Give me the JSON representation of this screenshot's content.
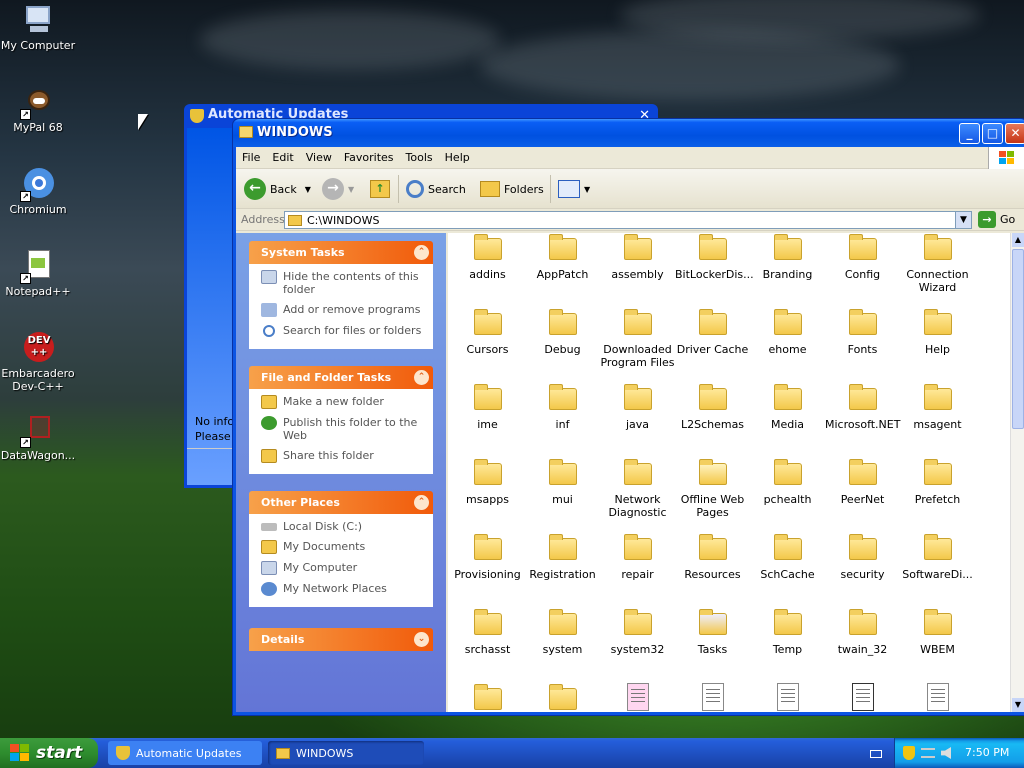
{
  "desktop": {
    "icons": [
      {
        "label": "My Computer"
      },
      {
        "label": "MyPal 68"
      },
      {
        "label": "Chromium"
      },
      {
        "label": "Notepad++"
      },
      {
        "label": "Embarcadero Dev-C++"
      },
      {
        "label": "DataWagon..."
      }
    ]
  },
  "back_window": {
    "title": "Automatic Updates",
    "text_line1": "No infor",
    "text_line2": "Please c"
  },
  "explorer": {
    "title": "WINDOWS",
    "menu": [
      "File",
      "Edit",
      "View",
      "Favorites",
      "Tools",
      "Help"
    ],
    "toolbar": {
      "back": "Back",
      "search": "Search",
      "folders": "Folders"
    },
    "address": {
      "label": "Address",
      "value": "C:\\WINDOWS",
      "go": "Go"
    },
    "tasks": {
      "system": {
        "title": "System Tasks",
        "items": [
          "Hide the contents of this folder",
          "Add or remove programs",
          "Search for files or folders"
        ]
      },
      "filefolder": {
        "title": "File and Folder Tasks",
        "items": [
          "Make a new folder",
          "Publish this folder to the Web",
          "Share this folder"
        ]
      },
      "other": {
        "title": "Other Places",
        "items": [
          "Local Disk (C:)",
          "My Documents",
          "My Computer",
          "My Network Places"
        ]
      },
      "details": {
        "title": "Details"
      }
    },
    "files": [
      "addins",
      "AppPatch",
      "assembly",
      "BitLockerDis...",
      "Branding",
      "Config",
      "Connection Wizard",
      "Cursors",
      "Debug",
      "Downloaded Program Files",
      "Driver Cache",
      "ehome",
      "Fonts",
      "Help",
      "ime",
      "inf",
      "java",
      "L2Schemas",
      "Media",
      "Microsoft.NET",
      "msagent",
      "msapps",
      "mui",
      "Network Diagnostic",
      "Offline Web Pages",
      "pchealth",
      "PeerNet",
      "Prefetch",
      "Provisioning",
      "Registration",
      "repair",
      "Resources",
      "SchCache",
      "security",
      "SoftwareDi...",
      "srchasst",
      "system",
      "system32",
      "Tasks",
      "Temp",
      "twain_32",
      "WBEM"
    ]
  },
  "taskbar": {
    "start": "start",
    "items": [
      "Automatic Updates",
      "WINDOWS"
    ],
    "clock": "7:50 PM"
  },
  "colors": {
    "taskbar": "#245edb",
    "start": "#2e8d2e",
    "panel_header": "#f15a0a",
    "title_blue": "#0051e0"
  }
}
